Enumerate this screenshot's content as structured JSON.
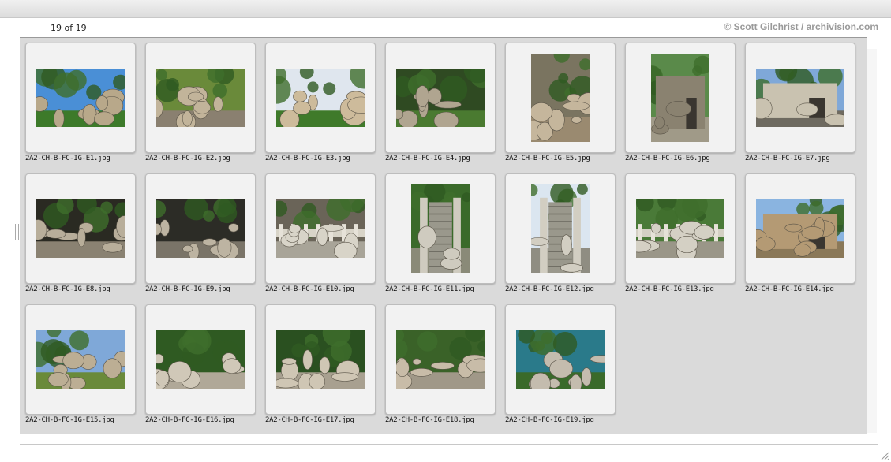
{
  "viewer": {
    "counter": "19 of 19",
    "credit": "© Scott Gilchrist / archivision.com"
  },
  "thumbnails": [
    {
      "filename": "2A2-CH-B-FC-IG-E1.jpg",
      "orientation": "landscape",
      "scene": "rockery-garden",
      "sky": "#4a8fd6",
      "ground": "#3d7a2a",
      "rock": "#b8a88a"
    },
    {
      "filename": "2A2-CH-B-FC-IG-E2.jpg",
      "orientation": "landscape",
      "scene": "rockery-garden",
      "sky": "#6a8a3a",
      "ground": "#8a8070",
      "rock": "#c2b49a"
    },
    {
      "filename": "2A2-CH-B-FC-IG-E3.jpg",
      "orientation": "landscape",
      "scene": "rockery-garden",
      "sky": "#dfe6ee",
      "ground": "#3f7a2a",
      "rock": "#cdbb9b"
    },
    {
      "filename": "2A2-CH-B-FC-IG-E4.jpg",
      "orientation": "landscape",
      "scene": "rockery-garden",
      "sky": "#2f4a22",
      "ground": "#4a7a30",
      "rock": "#b0a590"
    },
    {
      "filename": "2A2-CH-B-FC-IG-E5.jpg",
      "orientation": "portrait",
      "scene": "rock-cave",
      "sky": "#7a7460",
      "ground": "#9a8a70",
      "rock": "#c5b69c"
    },
    {
      "filename": "2A2-CH-B-FC-IG-E6.jpg",
      "orientation": "portrait",
      "scene": "pavilion",
      "sky": "#5a8a4a",
      "ground": "#a09a88",
      "rock": "#8a8270"
    },
    {
      "filename": "2A2-CH-B-FC-IG-E7.jpg",
      "orientation": "landscape",
      "scene": "pavilion",
      "sky": "#7fa8d8",
      "ground": "#6e6a60",
      "rock": "#c9c2b0"
    },
    {
      "filename": "2A2-CH-B-FC-IG-E8.jpg",
      "orientation": "landscape",
      "scene": "rock-cave",
      "sky": "#2a2a22",
      "ground": "#8a8272",
      "rock": "#b8ae9a"
    },
    {
      "filename": "2A2-CH-B-FC-IG-E9.jpg",
      "orientation": "landscape",
      "scene": "rock-cave",
      "sky": "#2c2c26",
      "ground": "#7a7468",
      "rock": "#bdb4a2"
    },
    {
      "filename": "2A2-CH-B-FC-IG-E10.jpg",
      "orientation": "landscape",
      "scene": "rockery-balustrade",
      "sky": "#6a6458",
      "ground": "#a8a498",
      "rock": "#d8d4c8"
    },
    {
      "filename": "2A2-CH-B-FC-IG-E11.jpg",
      "orientation": "portrait",
      "scene": "stairs",
      "sky": "#3a6a2a",
      "ground": "#8a8a78",
      "rock": "#cfcbbf"
    },
    {
      "filename": "2A2-CH-B-FC-IG-E12.jpg",
      "orientation": "portrait",
      "scene": "stairs",
      "sky": "#dbe6f0",
      "ground": "#8f8d82",
      "rock": "#d2cec2"
    },
    {
      "filename": "2A2-CH-B-FC-IG-E13.jpg",
      "orientation": "landscape",
      "scene": "terrace",
      "sky": "#4a7a38",
      "ground": "#9a9688",
      "rock": "#d4d0c4"
    },
    {
      "filename": "2A2-CH-B-FC-IG-E14.jpg",
      "orientation": "landscape",
      "scene": "wall-top",
      "sky": "#8ab4e0",
      "ground": "#8a7858",
      "rock": "#b49a74"
    },
    {
      "filename": "2A2-CH-B-FC-IG-E15.jpg",
      "orientation": "landscape",
      "scene": "carved-rock",
      "sky": "#7fa8d8",
      "ground": "#6a8a3a",
      "rock": "#bcae94"
    },
    {
      "filename": "2A2-CH-B-FC-IG-E16.jpg",
      "orientation": "landscape",
      "scene": "rockery-trees",
      "sky": "#2f5a22",
      "ground": "#b0a898",
      "rock": "#d0c8b8"
    },
    {
      "filename": "2A2-CH-B-FC-IG-E17.jpg",
      "orientation": "landscape",
      "scene": "rockery-trees",
      "sky": "#2a5020",
      "ground": "#a8a090",
      "rock": "#cfc6b4"
    },
    {
      "filename": "2A2-CH-B-FC-IG-E18.jpg",
      "orientation": "landscape",
      "scene": "rockery-trees",
      "sky": "#3a6228",
      "ground": "#a09888",
      "rock": "#c8bca8"
    },
    {
      "filename": "2A2-CH-B-FC-IG-E19.jpg",
      "orientation": "landscape",
      "scene": "rockery-trees",
      "sky": "#2a7a8a",
      "ground": "#3a6a2a",
      "rock": "#c4bcae"
    }
  ]
}
